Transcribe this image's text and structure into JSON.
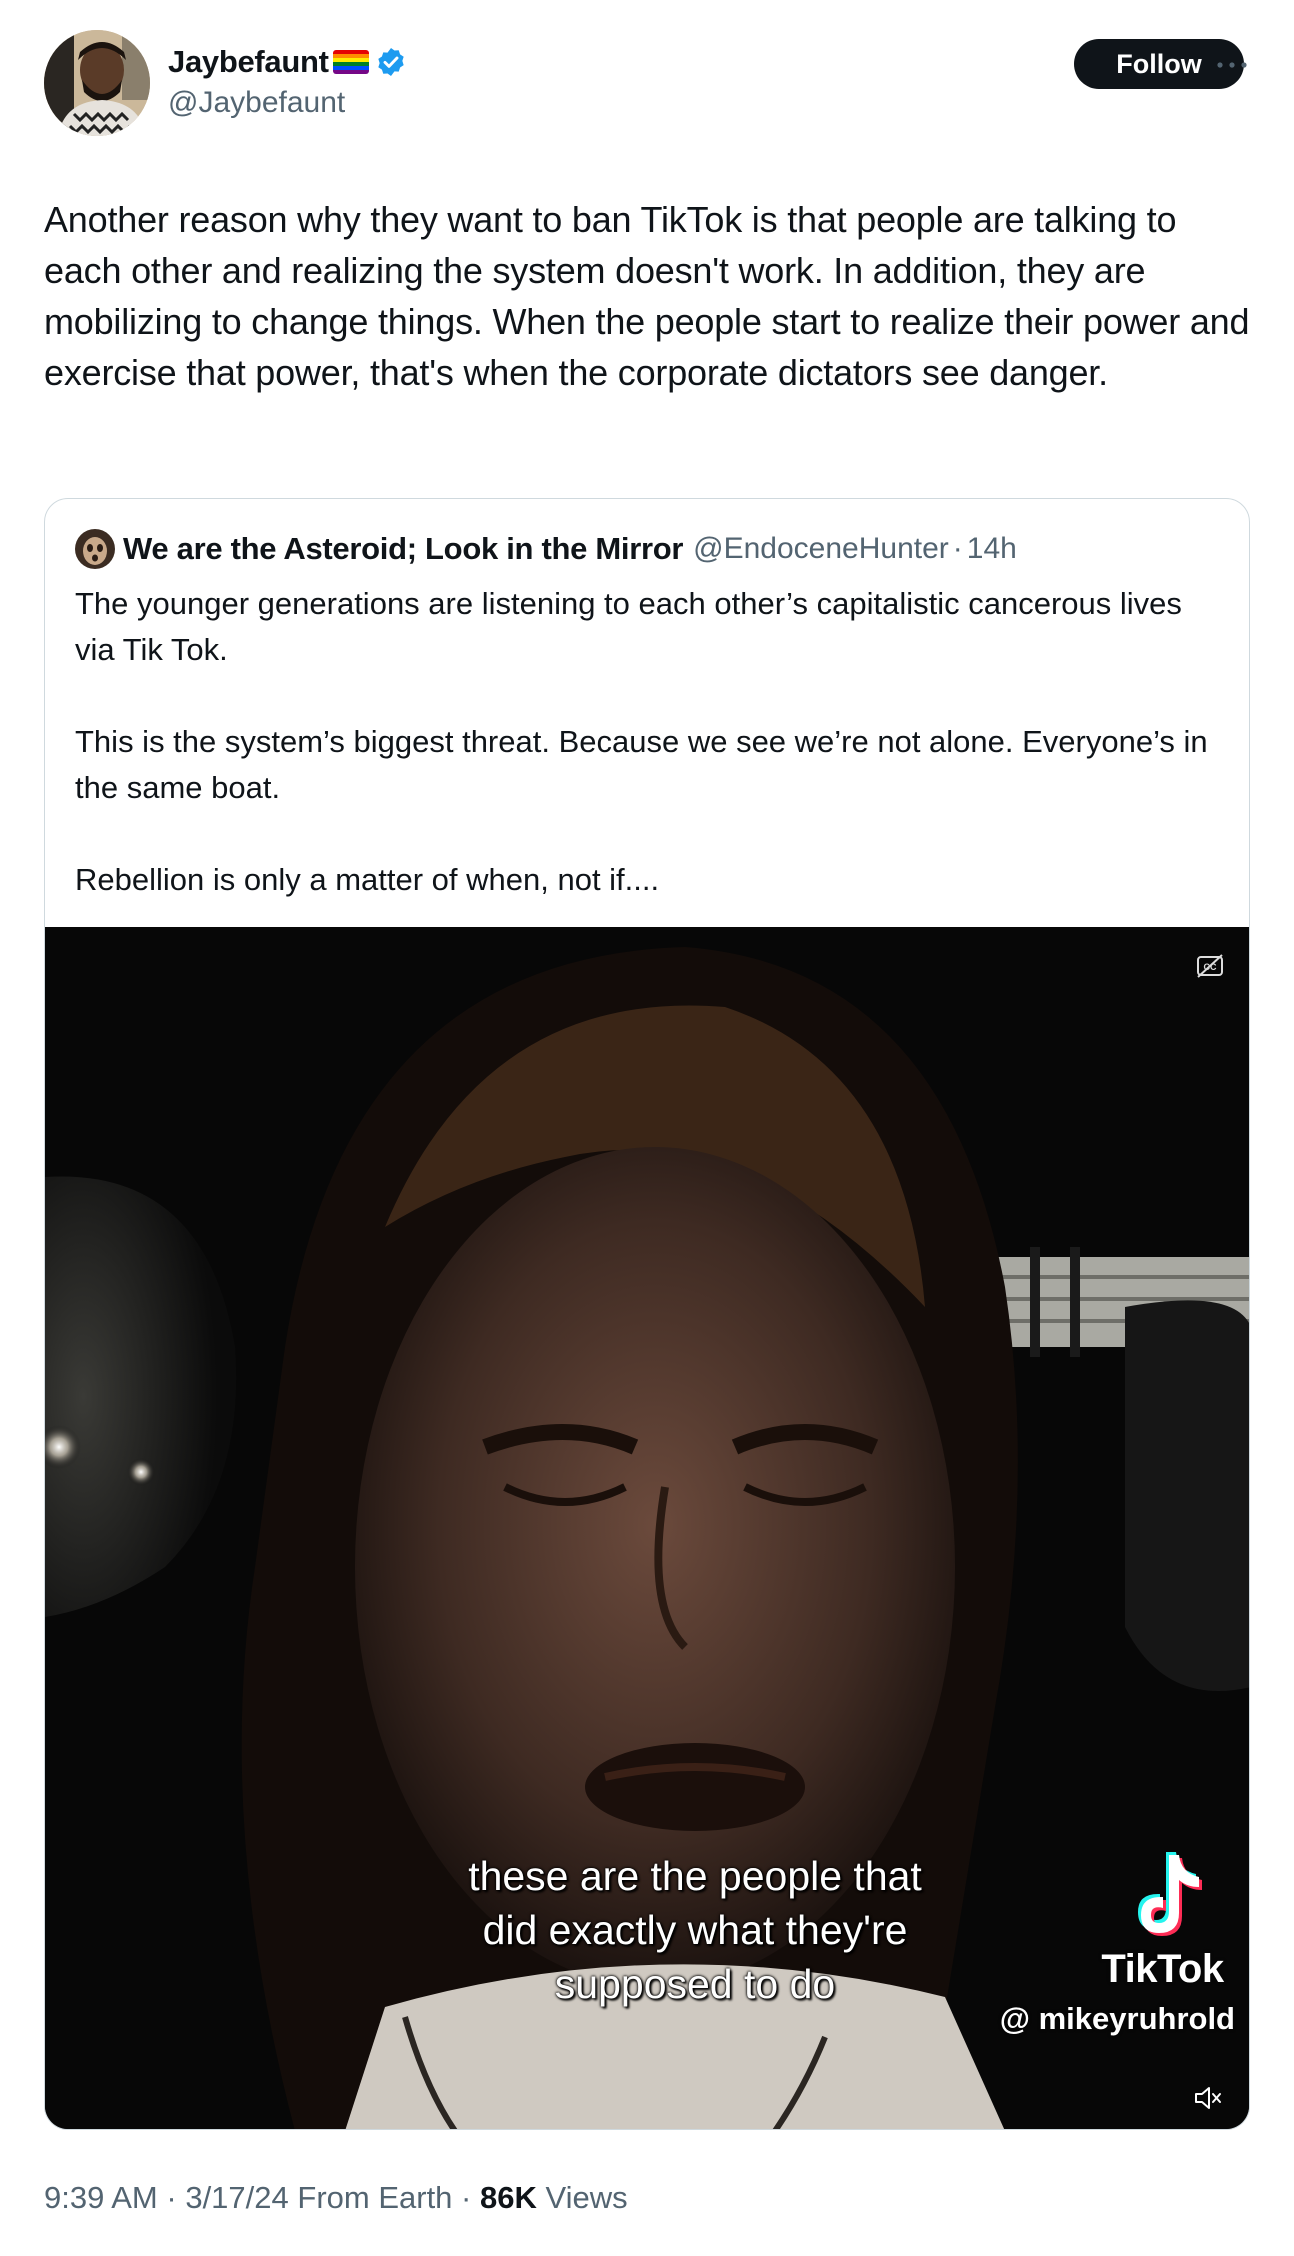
{
  "author": {
    "display_name": "Jaybefaunt",
    "handle": "@Jaybefaunt",
    "name_emoji": "rainbow-flag-icon",
    "verified_icon": "verified-badge-icon",
    "avatar": "avatar-photo"
  },
  "actions": {
    "follow_label": "Follow",
    "more_icon": "more-options-icon"
  },
  "tweet": {
    "text": "Another reason why they want to ban TikTok is that people are talking to each other and realizing the system doesn't work. In addition, they are mobilizing to change things. When the people start to realize their power and exercise that power, that's when the corporate dictators see danger."
  },
  "quoted_tweet": {
    "display_name": "We are the Asteroid; Look in the Mirror",
    "handle": "@EndoceneHunter",
    "separator": "·",
    "time": "14h",
    "paragraphs": [
      "The younger generations are listening to each other’s capitalistic cancerous lives via Tik Tok.",
      "This is the system’s biggest threat. Because we see we’re not alone. Everyone’s in the same boat.",
      "Rebellion is only a matter of when, not if...."
    ],
    "video": {
      "caption_lines": [
        "these are the people that",
        "did exactly what they're",
        "supposed to do"
      ],
      "watermark_brand": "TikTok",
      "watermark_user": "@ mikeyruhrold",
      "cc_icon": "closed-captions-off-icon",
      "mute_icon": "muted-speaker-icon"
    }
  },
  "meta": {
    "time": "9:39 AM",
    "sep1": "·",
    "date": "3/17/24",
    "location": "From Earth",
    "sep2": "·",
    "views_count": "86K",
    "views_label": "Views"
  },
  "colors": {
    "text_primary": "#0f1419",
    "text_secondary": "#536471",
    "verified_blue": "#1d9bf0",
    "border": "#cfd9de",
    "button_bg": "#0f1419"
  }
}
